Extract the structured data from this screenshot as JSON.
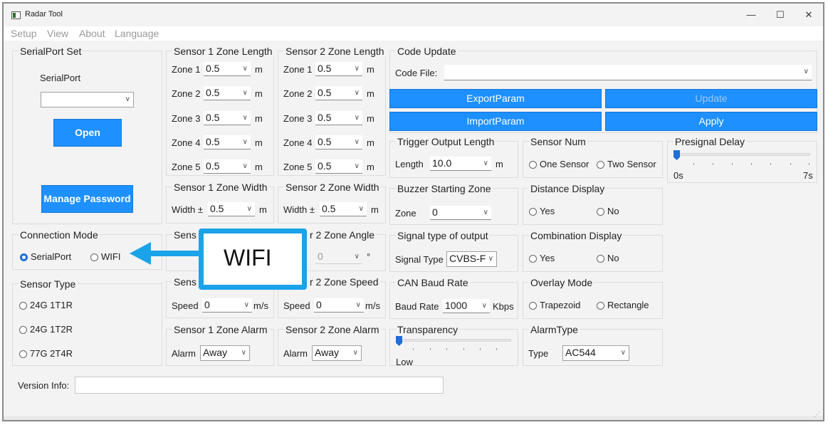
{
  "window": {
    "title": "Radar Tool",
    "minimize": "—",
    "maximize": "☐",
    "close": "✕"
  },
  "menu": [
    "Setup",
    "View",
    "About",
    "Language"
  ],
  "serial": {
    "group": "SerialPort Set",
    "label": "SerialPort",
    "port_value": "",
    "open": "Open",
    "manage_password": "Manage Password"
  },
  "connection": {
    "group": "Connection Mode",
    "options": [
      "SerialPort",
      "WIFI"
    ],
    "selected": "SerialPort"
  },
  "sensor_type": {
    "group": "Sensor Type",
    "options": [
      "24G 1T1R",
      "24G 1T2R",
      "77G 2T4R"
    ]
  },
  "s1_len": {
    "group": "Sensor 1 Zone Length",
    "zones": [
      {
        "label": "Zone 1",
        "value": "0.5",
        "unit": "m"
      },
      {
        "label": "Zone 2",
        "value": "0.5",
        "unit": "m"
      },
      {
        "label": "Zone 3",
        "value": "0.5",
        "unit": "m"
      },
      {
        "label": "Zone 4",
        "value": "0.5",
        "unit": "m"
      },
      {
        "label": "Zone 5",
        "value": "0.5",
        "unit": "m"
      }
    ]
  },
  "s2_len": {
    "group": "Sensor 2 Zone Length",
    "zones": [
      {
        "label": "Zone 1",
        "value": "0.5",
        "unit": "m"
      },
      {
        "label": "Zone 2",
        "value": "0.5",
        "unit": "m"
      },
      {
        "label": "Zone 3",
        "value": "0.5",
        "unit": "m"
      },
      {
        "label": "Zone 4",
        "value": "0.5",
        "unit": "m"
      },
      {
        "label": "Zone 5",
        "value": "0.5",
        "unit": "m"
      }
    ]
  },
  "s1_width": {
    "group": "Sensor 1 Zone Width",
    "label": "Width ±",
    "value": "0.5",
    "unit": "m"
  },
  "s2_width": {
    "group": "Sensor 2 Zone Width",
    "label": "Width ±",
    "value": "0.5",
    "unit": "m"
  },
  "s1_angle": {
    "group": "Sensor 1 Zone Angle",
    "visible": "Sens"
  },
  "s2_angle": {
    "group": "r 2 Zone Angle",
    "value": "0",
    "unit": "°"
  },
  "s1_speed": {
    "group": "Sens",
    "label": "Speed",
    "value": "0",
    "unit": "m/s"
  },
  "s2_speed": {
    "group": "r 2 Zone Speed",
    "label": "Speed",
    "value": "0",
    "unit": "m/s"
  },
  "s1_alarm": {
    "group": "Sensor 1 Zone Alarm",
    "label": "Alarm",
    "value": "Away"
  },
  "s2_alarm": {
    "group": "Sensor 2 Zone Alarm",
    "label": "Alarm",
    "value": "Away"
  },
  "code_update": {
    "group": "Code Update",
    "label": "Code File:",
    "value": "",
    "export": "ExportParam",
    "update": "Update",
    "import": "ImportParam",
    "apply": "Apply"
  },
  "trigger": {
    "group": "Trigger Output Length",
    "label": "Length",
    "value": "10.0",
    "unit": "m"
  },
  "sensor_num": {
    "group": "Sensor Num",
    "options": [
      "One Sensor",
      "Two Sensor"
    ]
  },
  "presignal": {
    "group": "Presignal Delay",
    "min": "0s",
    "max": "7s",
    "level": 0
  },
  "buzzer": {
    "group": "Buzzer Starting Zone",
    "label": "Zone",
    "value": "0"
  },
  "distance": {
    "group": "Distance Display",
    "options": [
      "Yes",
      "No"
    ]
  },
  "signal": {
    "group": "Signal type of output",
    "label": "Signal Type",
    "value": "CVBS-F"
  },
  "combination": {
    "group": "Combination Display",
    "options": [
      "Yes",
      "No"
    ]
  },
  "can": {
    "group": "CAN Baud Rate",
    "label": "Baud Rate",
    "value": "1000",
    "unit": "Kbps"
  },
  "overlay": {
    "group": "Overlay Mode",
    "options": [
      "Trapezoid",
      "Rectangle"
    ]
  },
  "transparency": {
    "group": "Transparency",
    "min": "Low",
    "level": 0
  },
  "alarm_type": {
    "group": "AlarmType",
    "label": "Type",
    "value": "AC544"
  },
  "version": {
    "label": "Version Info:",
    "value": ""
  },
  "callout": {
    "text": "WIFI"
  },
  "colors": {
    "accent": "#1e90ff",
    "callout": "#1aa3e8",
    "radio_on": "#1e6fd6"
  }
}
